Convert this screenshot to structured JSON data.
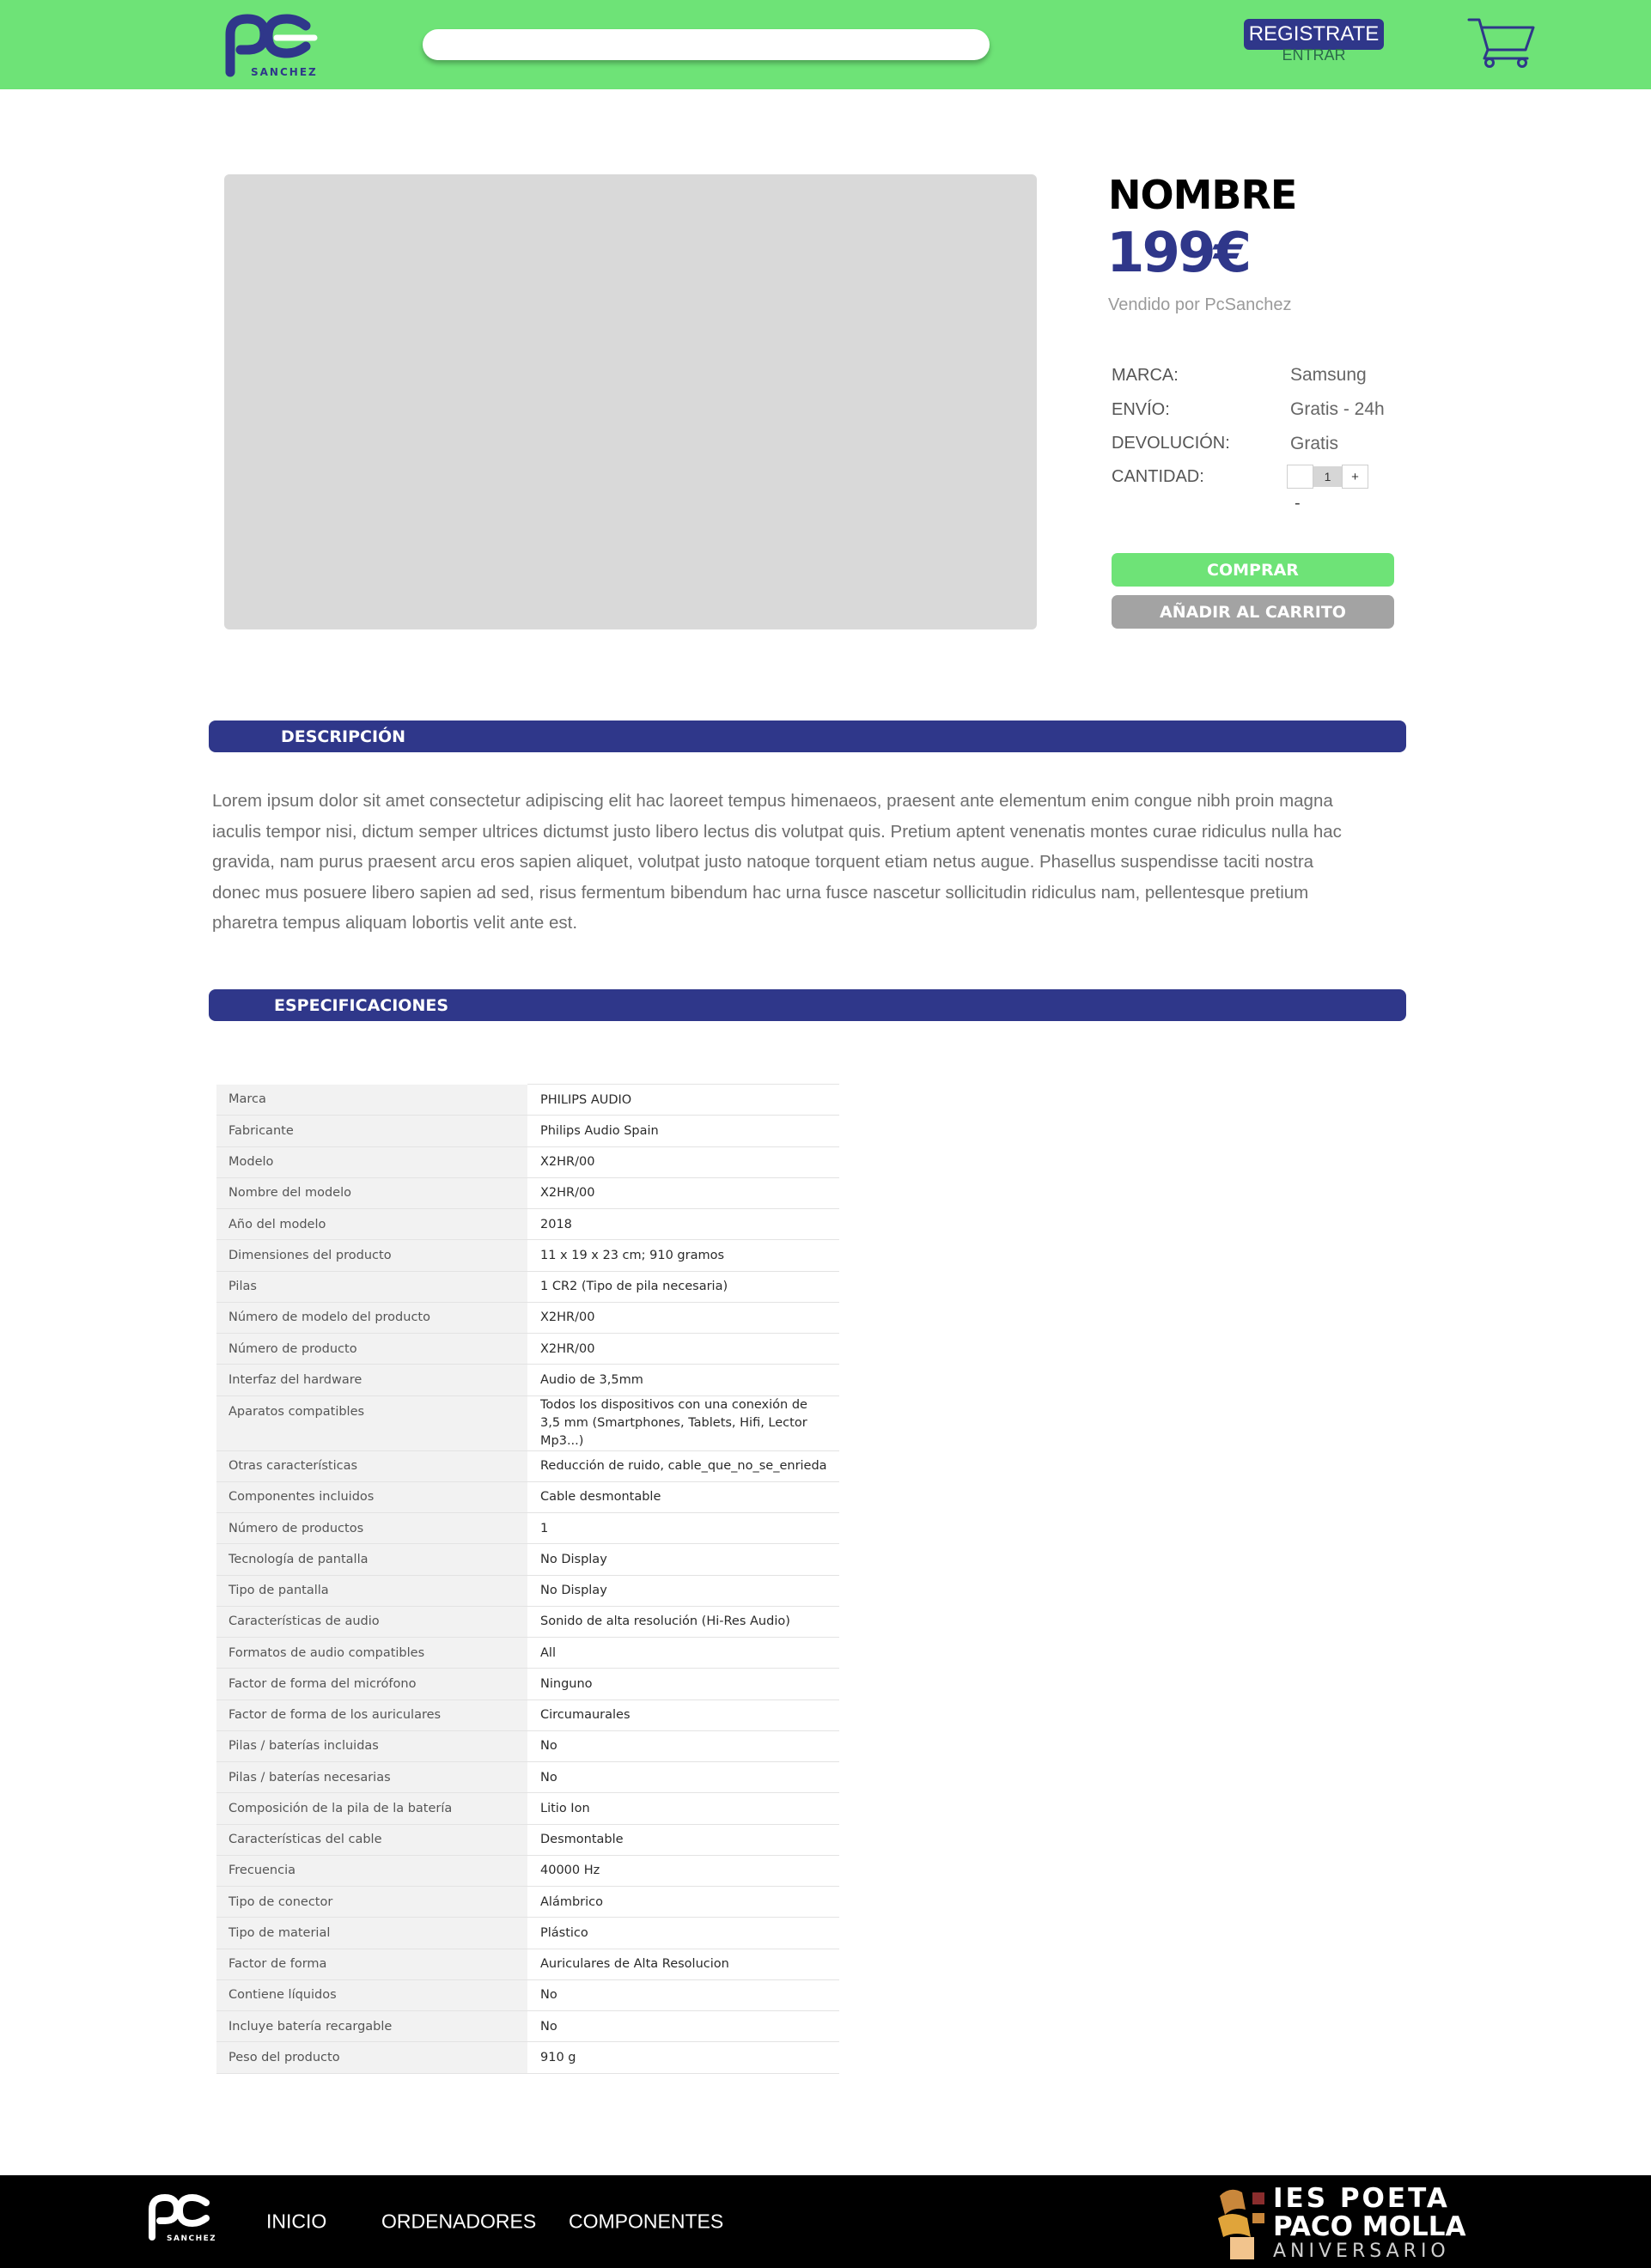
{
  "header": {
    "logo_text": "SANCHEZ",
    "search": {
      "value": "",
      "placeholder": ""
    },
    "register_label": "REGISTRATE",
    "login_label": "ENTRAR"
  },
  "product": {
    "name": "NOMBRE",
    "price": "199€",
    "seller": "Vendido por PcSanchez",
    "attributes": [
      {
        "label": "MARCA:",
        "value": "Samsung"
      },
      {
        "label": "ENVÍO:",
        "value": "Gratis - 24h"
      },
      {
        "label": "DEVOLUCIÓN:",
        "value": "Gratis"
      },
      {
        "label": "CANTIDAD:",
        "value": ""
      }
    ],
    "quantity": {
      "value": "1",
      "plus": "+",
      "minus": "-"
    },
    "buy_label": "COMPRAR",
    "add_to_cart_label": "AÑADIR AL CARRITO"
  },
  "description": {
    "heading": "DESCRIPCIÓN",
    "text": "Lorem ipsum dolor sit amet consectetur adipiscing elit hac laoreet tempus himenaeos, praesent ante elementum enim congue nibh proin magna iaculis tempor nisi, dictum semper ultrices dictumst justo libero lectus dis volutpat quis. Pretium aptent venenatis montes curae ridiculus nulla hac gravida, nam purus praesent arcu eros sapien aliquet, volutpat justo natoque torquent etiam netus augue. Phasellus suspendisse taciti nostra donec mus posuere libero sapien ad sed, risus fermentum bibendum hac urna fusce nascetur sollicitudin ridiculus nam, pellentesque pretium pharetra tempus aliquam lobortis velit ante est."
  },
  "specifications": {
    "heading": "ESPECIFICACIONES",
    "rows": [
      {
        "key": "Marca",
        "value": "PHILIPS AUDIO"
      },
      {
        "key": "Fabricante",
        "value": "Philips Audio Spain"
      },
      {
        "key": "Modelo",
        "value": "X2HR/00"
      },
      {
        "key": "Nombre del modelo",
        "value": "X2HR/00"
      },
      {
        "key": "Año del modelo",
        "value": "2018"
      },
      {
        "key": "Dimensiones del producto",
        "value": "11 x 19 x 23 cm; 910 gramos"
      },
      {
        "key": "Pilas",
        "value": "1 CR2 (Tipo de pila necesaria)"
      },
      {
        "key": "Número de modelo del producto",
        "value": "X2HR/00"
      },
      {
        "key": "Número de producto",
        "value": "X2HR/00"
      },
      {
        "key": "Interfaz del hardware",
        "value": "Audio de 3,5mm"
      },
      {
        "key": "Aparatos compatibles",
        "value": "Todos los dispositivos con una conexión de 3,5 mm (Smartphones, Tablets, Hifi, Lector Mp3...)"
      },
      {
        "key": "Otras características",
        "value": "Reducción de ruido, cable_que_no_se_enrieda"
      },
      {
        "key": "Componentes incluidos",
        "value": "Cable desmontable"
      },
      {
        "key": "Número de productos",
        "value": "1"
      },
      {
        "key": "Tecnología de pantalla",
        "value": "No Display"
      },
      {
        "key": "Tipo de pantalla",
        "value": "No Display"
      },
      {
        "key": "Características de audio",
        "value": "Sonido de alta resolución (Hi-Res Audio)"
      },
      {
        "key": "Formatos de audio compatibles",
        "value": "All"
      },
      {
        "key": "Factor de forma del micrófono",
        "value": "Ninguno"
      },
      {
        "key": "Factor de forma de los auriculares",
        "value": "Circumaurales"
      },
      {
        "key": "Pilas / baterías incluidas",
        "value": "No"
      },
      {
        "key": "Pilas / baterías necesarias",
        "value": "No"
      },
      {
        "key": "Composición de la pila de la batería",
        "value": "Litio Ion"
      },
      {
        "key": "Características del cable",
        "value": "Desmontable"
      },
      {
        "key": "Frecuencia",
        "value": "40000 Hz"
      },
      {
        "key": "Tipo de conector",
        "value": "Alámbrico"
      },
      {
        "key": "Tipo de material",
        "value": "Plástico"
      },
      {
        "key": "Factor de forma",
        "value": "Auriculares de Alta Resolucion"
      },
      {
        "key": "Contiene líquidos",
        "value": "No"
      },
      {
        "key": "Incluye batería recargable",
        "value": "No"
      },
      {
        "key": "Peso del producto",
        "value": "910 g"
      }
    ]
  },
  "footer": {
    "logo_text": "SANCHEZ",
    "links": [
      "INICIO",
      "ORDENADORES",
      "COMPONENTES"
    ],
    "school": {
      "line1": "IES POETA",
      "line2": "PACO MOLLA",
      "line3": "ANIVERSARIO"
    }
  },
  "colors": {
    "header_bg": "#6ee377",
    "brand_blue": "#2f378a",
    "buy_green": "#6ee377",
    "cart_button_gray": "#a3a3a3",
    "footer_bg": "#000000"
  },
  "icons": [
    "pc-sanchez-logo",
    "cart-icon",
    "ies-poeta-paco-molla-logo"
  ]
}
